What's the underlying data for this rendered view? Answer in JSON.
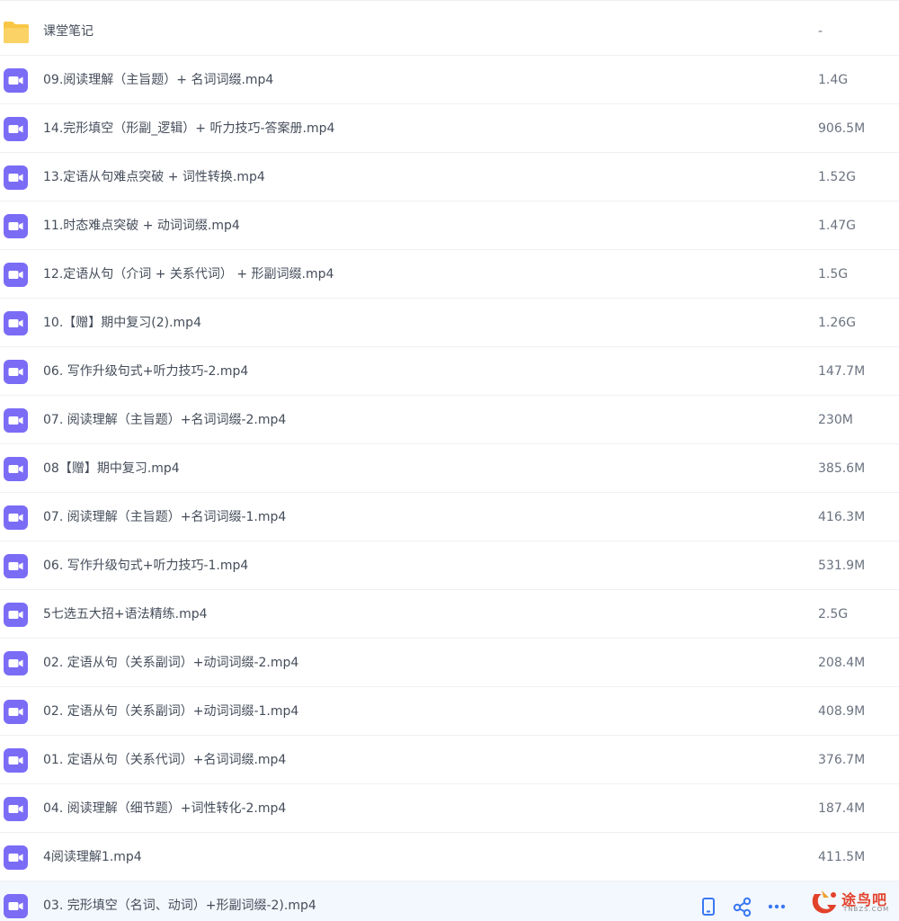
{
  "colors": {
    "folder": "#f9c745",
    "video_icon": "#7b6cf6",
    "accent": "#3a78f2",
    "watermark": "#e2412a"
  },
  "files": [
    {
      "name": "课堂笔记",
      "size": "-",
      "icon": "folder-icon"
    },
    {
      "name": "09.阅读理解（主旨题）+ 名词词缀.mp4",
      "size": "1.4G",
      "icon": "video-file-icon"
    },
    {
      "name": "14.完形填空（形副_逻辑）+ 听力技巧-答案册.mp4",
      "size": "906.5M",
      "icon": "video-file-icon"
    },
    {
      "name": "13.定语从句难点突破 + 词性转换.mp4",
      "size": "1.52G",
      "icon": "video-file-icon"
    },
    {
      "name": "11.时态难点突破 + 动词词缀.mp4",
      "size": "1.47G",
      "icon": "video-file-icon"
    },
    {
      "name": "12.定语从句（介词 + 关系代词） + 形副词缀.mp4",
      "size": "1.5G",
      "icon": "video-file-icon"
    },
    {
      "name": "10.【赠】期中复习(2).mp4",
      "size": "1.26G",
      "icon": "video-file-icon"
    },
    {
      "name": "06. 写作升级句式+听力技巧-2.mp4",
      "size": "147.7M",
      "icon": "video-file-icon"
    },
    {
      "name": "07. 阅读理解（主旨题）+名词词缀-2.mp4",
      "size": "230M",
      "icon": "video-file-icon"
    },
    {
      "name": "08【赠】期中复习.mp4",
      "size": "385.6M",
      "icon": "video-file-icon"
    },
    {
      "name": "07. 阅读理解（主旨题）+名词词缀-1.mp4",
      "size": "416.3M",
      "icon": "video-file-icon"
    },
    {
      "name": "06. 写作升级句式+听力技巧-1.mp4",
      "size": "531.9M",
      "icon": "video-file-icon"
    },
    {
      "name": "5七选五大招+语法精练.mp4",
      "size": "2.5G",
      "icon": "video-file-icon"
    },
    {
      "name": "02. 定语从句（关系副词）+动词词缀-2.mp4",
      "size": "208.4M",
      "icon": "video-file-icon"
    },
    {
      "name": "02. 定语从句（关系副词）+动词词缀-1.mp4",
      "size": "408.9M",
      "icon": "video-file-icon"
    },
    {
      "name": "01. 定语从句（关系代词）+名词词缀.mp4",
      "size": "376.7M",
      "icon": "video-file-icon"
    },
    {
      "name": "04. 阅读理解（细节题）+词性转化-2.mp4",
      "size": "187.4M",
      "icon": "video-file-icon"
    },
    {
      "name": "4阅读理解1.mp4",
      "size": "411.5M",
      "icon": "video-file-icon"
    },
    {
      "name": "03. 完形填空（名词、动词）+形副词缀-2).mp4",
      "size": "",
      "icon": "video-file-icon",
      "hovered": true
    }
  ],
  "row_actions": [
    "phone-icon",
    "share-icon",
    "more-icon"
  ],
  "watermark": {
    "text": "途鸟吧",
    "sub": "TNBZS.COM",
    "logo": "tuniaoba-logo"
  }
}
